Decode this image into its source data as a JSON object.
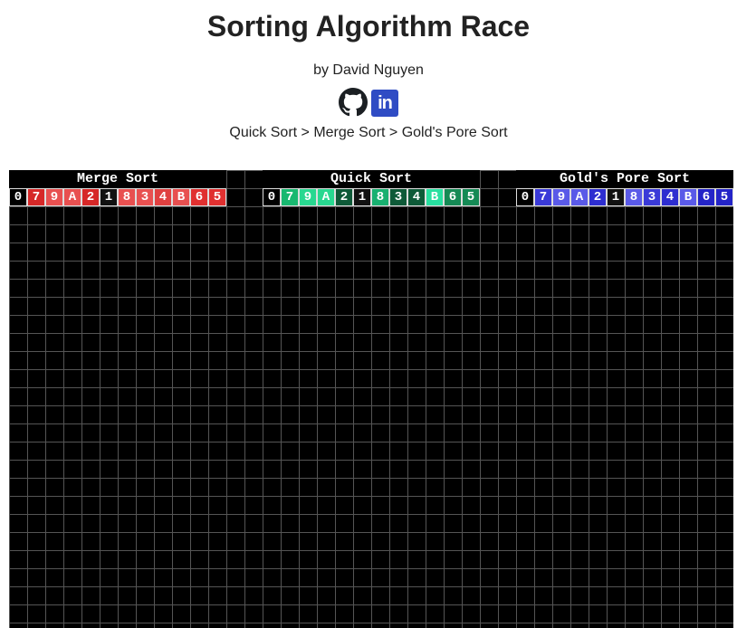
{
  "title": "Sorting Algorithm Race",
  "byline": "by David Nguyen",
  "social": {
    "github_icon": "github-icon",
    "linkedin_label": "in"
  },
  "ranking": "Quick Sort > Merge Sort > Gold's Pore Sort",
  "values": [
    "0",
    "7",
    "9",
    "A",
    "2",
    "1",
    "8",
    "3",
    "4",
    "B",
    "6",
    "5"
  ],
  "lanes": [
    {
      "title": "Merge Sort",
      "colors": [
        "#000000",
        "#d62828",
        "#e85050",
        "#e85050",
        "#d62828",
        "#111111",
        "#e85050",
        "#e85050",
        "#e04040",
        "#e85050",
        "#e03030",
        "#e03030"
      ]
    },
    {
      "title": "Quick Sort",
      "colors": [
        "#000000",
        "#18b870",
        "#28d890",
        "#28d890",
        "#0e5a38",
        "#111111",
        "#18b070",
        "#0e5a38",
        "#0e5a38",
        "#28e0a0",
        "#158a55",
        "#158a55"
      ]
    },
    {
      "title": "Gold's Pore Sort",
      "colors": [
        "#000000",
        "#3a3ad8",
        "#5a5ae8",
        "#5a5ae8",
        "#2e2ed0",
        "#111111",
        "#5a5ae8",
        "#3a3ad8",
        "#2e2ed0",
        "#5a5ae8",
        "#2424c8",
        "#2424c8"
      ]
    }
  ]
}
